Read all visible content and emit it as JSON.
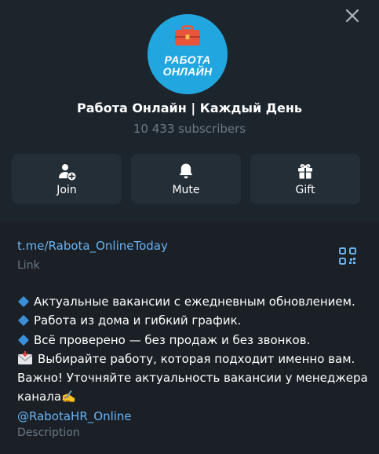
{
  "channel": {
    "avatar_text_line1": "РАБОТА",
    "avatar_text_line2": "ОНЛАЙН",
    "title": "Работа Онлайн | Каждый День",
    "subscribers": "10 433 subscribers"
  },
  "actions": [
    {
      "label": "Join",
      "icon": "add-user-icon"
    },
    {
      "label": "Mute",
      "icon": "bell-icon"
    },
    {
      "label": "Gift",
      "icon": "gift-icon"
    }
  ],
  "link": {
    "url": "t.me/Rabota_OnlineToday",
    "caption": "Link"
  },
  "description": {
    "lines": [
      "Актуальные вакансии с ежедневным обновлением.",
      "Работа из дома и гибкий график.",
      "Всё проверено — без продаж и без звонков.",
      "Выбирайте работу, которая подходит именно вам.",
      "Важно! Уточняйте актуальность вакансии у менеджера",
      "канала✍️"
    ],
    "mention": "@RabotaHR_Online",
    "caption": "Description"
  },
  "colors": {
    "accent": "#6ab3f3",
    "avatar_bg": "#22a6df",
    "background": "#1a2026",
    "header_bg": "#1d252c",
    "button_bg": "#232e37",
    "muted_text": "#6c7883"
  }
}
